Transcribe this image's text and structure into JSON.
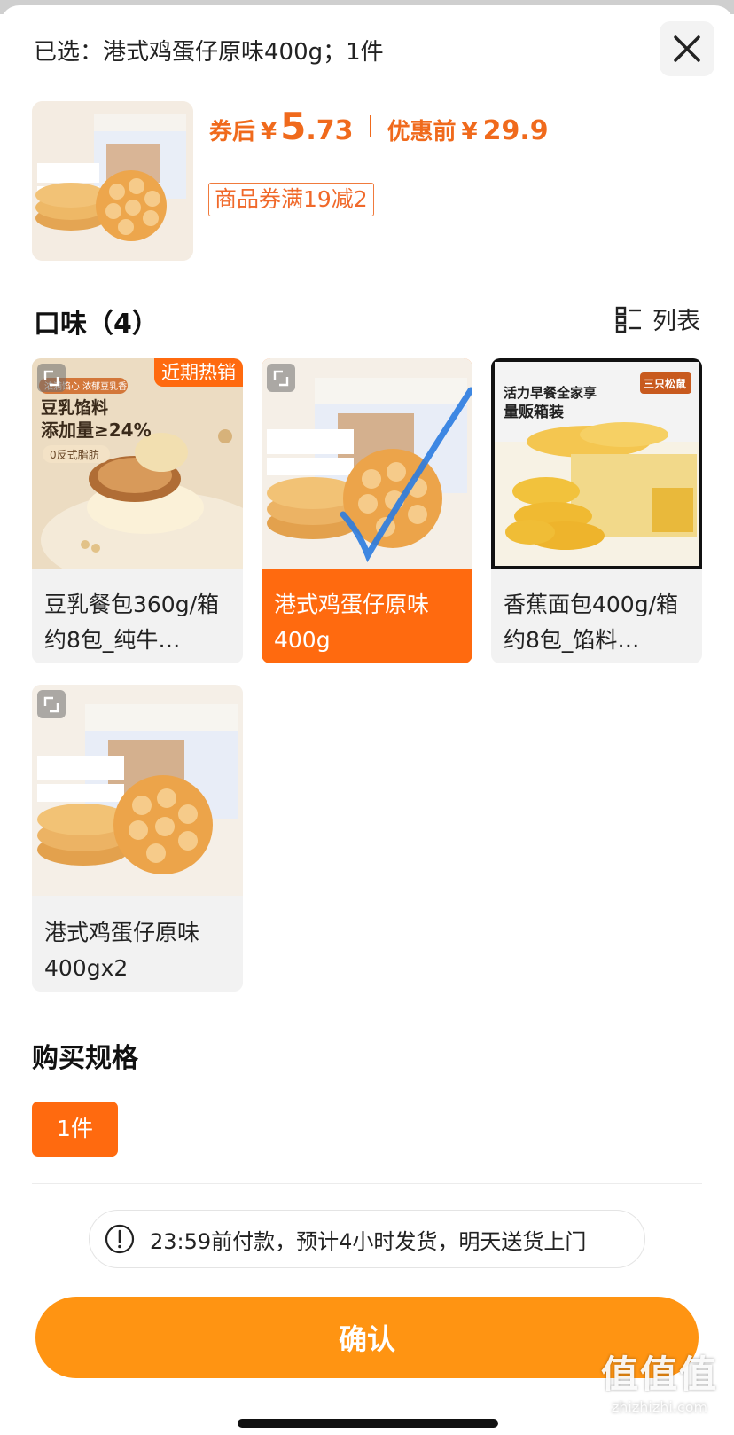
{
  "header": {
    "selected_text": "已选：港式鸡蛋仔原味400g；1件"
  },
  "price": {
    "after_coupon_label": "券后",
    "currency": "¥",
    "after_coupon_int": "5",
    "after_coupon_dec": ".73",
    "original_label": "优惠前",
    "original_value": "29.9"
  },
  "coupon_tag": "商品券满19减2",
  "flavor_section": {
    "title": "口味（4）",
    "list_toggle_label": "列表"
  },
  "flavors": [
    {
      "name": "豆乳餐包360g/箱约8包_纯牛…",
      "badge": "近期热销",
      "selected": false,
      "image_text_1": "豆乳馅料",
      "image_text_2": "添加量≥24%",
      "image_text_3": "0反式脂肪"
    },
    {
      "name": "港式鸡蛋仔原味400g",
      "selected": true
    },
    {
      "name": "香蕉面包400g/箱约8包_馅料…",
      "selected": false,
      "image_text_1": "活力早餐全家享",
      "image_text_2": "量贩箱装",
      "image_text_3": "三只松鼠"
    },
    {
      "name": "港式鸡蛋仔原味400gx2",
      "selected": false
    }
  ],
  "spec_section": {
    "title": "购买规格",
    "options": [
      "1件"
    ]
  },
  "notice_text": "23:59前付款，预计4小时发货，明天送货上门",
  "confirm_label": "确认",
  "watermark": {
    "big": "值值值",
    "small": "zhizhizhi.com"
  },
  "colors": {
    "accent": "#ff6a0f",
    "confirm": "#ff9412",
    "price": "#f06a1c"
  }
}
